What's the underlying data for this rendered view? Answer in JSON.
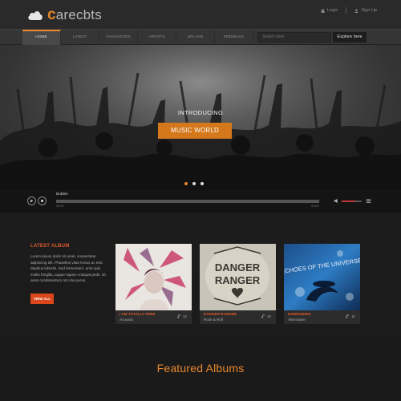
{
  "app": {
    "logo_text": "arecbts",
    "logo_initial": "c"
  },
  "auth": {
    "login_label": "Login",
    "signup_label": "Sign Up"
  },
  "nav": {
    "items": [
      "HOME",
      "LATEST",
      "FAVOURITES",
      "ARTISTS",
      "UPLOAD",
      "FEEDBACK"
    ],
    "active_index": 0,
    "search_placeholder": "Search here",
    "explore_label": "Explore here"
  },
  "hero": {
    "intro": "INTRODUCING",
    "headline": "MUSIC WORLD",
    "slide_count": 3,
    "active_slide": 0
  },
  "player": {
    "track": "Bubble",
    "elapsed": "00:00",
    "duration": "00:00",
    "volume": 0.7
  },
  "latest": {
    "title": "LATEST ALBUM",
    "body": "Lorem ipsum dolor sit amet, consectetur adipiscing elit. Phasellus vitae lectus ac erat dapibus lobortis. Sed fermentum, ante quis mollis fringilla, augue sapien volutpat pede, sit amet condimentum orci dui purus.",
    "button_label": "VIEW ALL"
  },
  "albums": [
    {
      "title": "I AM TOTALLY FREE",
      "genre": "Acoustic",
      "count": "12"
    },
    {
      "title": "DANGER RANGER",
      "genre": "Rock & Roll",
      "count": "10",
      "art_text_1": "DANGER",
      "art_text_2": "RANGER"
    },
    {
      "title": "HOMOGENIC",
      "genre": "Alternative",
      "count": "11",
      "art_text": "ECHOES OF THE UNIVERSE"
    }
  ],
  "featured_title": "Featured Albums",
  "colors": {
    "accent": "#e8872b",
    "red": "#d9471b",
    "background": "#1c1c1c"
  }
}
